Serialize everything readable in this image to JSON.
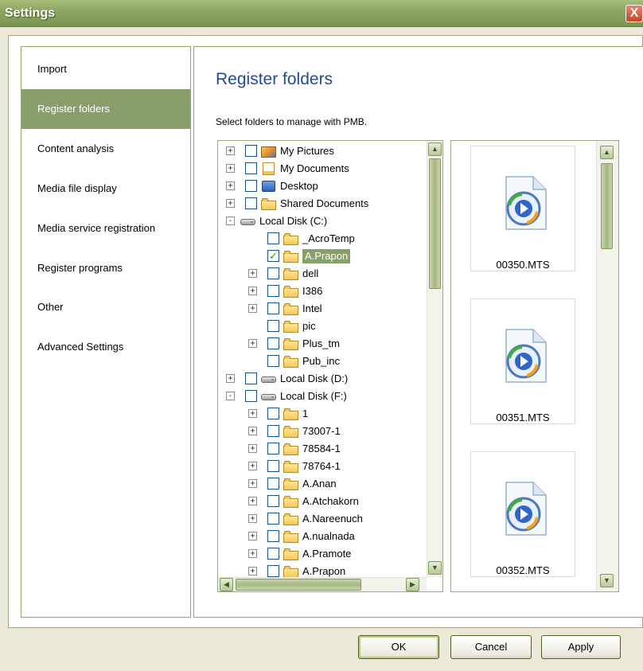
{
  "window": {
    "title": "Settings",
    "close_symbol": "X"
  },
  "nav": {
    "items": [
      {
        "label": "Import",
        "selected": false
      },
      {
        "label": "Register folders",
        "selected": true
      },
      {
        "label": "Content analysis",
        "selected": false
      },
      {
        "label": "Media file display",
        "selected": false
      },
      {
        "label": "Media service registration",
        "selected": false
      },
      {
        "label": "Register programs",
        "selected": false
      },
      {
        "label": "Other",
        "selected": false
      },
      {
        "label": "Advanced Settings",
        "selected": false
      }
    ]
  },
  "main": {
    "heading": "Register folders",
    "subtitle": "Select folders to manage with PMB."
  },
  "tree": {
    "items": [
      {
        "label": "My Pictures",
        "level": 0,
        "expander": "+",
        "checked": false,
        "icon": "pictures-icon"
      },
      {
        "label": "My Documents",
        "level": 0,
        "expander": "+",
        "checked": false,
        "icon": "documents-icon"
      },
      {
        "label": "Desktop",
        "level": 0,
        "expander": "+",
        "checked": false,
        "icon": "desktop-icon"
      },
      {
        "label": "Shared Documents",
        "level": 0,
        "expander": "+",
        "checked": false,
        "icon": "folder-icon"
      },
      {
        "label": "Local Disk (C:)",
        "level": 0,
        "expander": "-",
        "checked": null,
        "icon": "drive-icon"
      },
      {
        "label": "_AcroTemp",
        "level": 1,
        "expander": "",
        "checked": false,
        "icon": "folder-icon"
      },
      {
        "label": "A.Prapon",
        "level": 1,
        "expander": "",
        "checked": true,
        "icon": "folder-icon",
        "selected": true
      },
      {
        "label": "dell",
        "level": 1,
        "expander": "+",
        "checked": false,
        "icon": "folder-icon"
      },
      {
        "label": "I386",
        "level": 1,
        "expander": "+",
        "checked": false,
        "icon": "folder-icon"
      },
      {
        "label": "Intel",
        "level": 1,
        "expander": "+",
        "checked": false,
        "icon": "folder-icon"
      },
      {
        "label": "pic",
        "level": 1,
        "expander": "",
        "checked": false,
        "icon": "folder-icon"
      },
      {
        "label": "Plus_tm",
        "level": 1,
        "expander": "+",
        "checked": false,
        "icon": "folder-icon"
      },
      {
        "label": "Pub_inc",
        "level": 1,
        "expander": "",
        "checked": false,
        "icon": "folder-icon"
      },
      {
        "label": "Local Disk (D:)",
        "level": 0,
        "expander": "+",
        "checked": false,
        "icon": "drive-icon"
      },
      {
        "label": "Local Disk (F:)",
        "level": 0,
        "expander": "-",
        "checked": false,
        "icon": "drive-icon"
      },
      {
        "label": "1",
        "level": 1,
        "expander": "+",
        "checked": false,
        "icon": "folder-icon"
      },
      {
        "label": "73007-1",
        "level": 1,
        "expander": "+",
        "checked": false,
        "icon": "folder-icon"
      },
      {
        "label": "78584-1",
        "level": 1,
        "expander": "+",
        "checked": false,
        "icon": "folder-icon"
      },
      {
        "label": "78764-1",
        "level": 1,
        "expander": "+",
        "checked": false,
        "icon": "folder-icon"
      },
      {
        "label": "A.Anan",
        "level": 1,
        "expander": "+",
        "checked": false,
        "icon": "folder-icon"
      },
      {
        "label": "A.Atchakorn",
        "level": 1,
        "expander": "+",
        "checked": false,
        "icon": "folder-icon"
      },
      {
        "label": "A.Nareenuch",
        "level": 1,
        "expander": "+",
        "checked": false,
        "icon": "folder-icon"
      },
      {
        "label": "A.nualnada",
        "level": 1,
        "expander": "+",
        "checked": false,
        "icon": "folder-icon"
      },
      {
        "label": "A.Pramote",
        "level": 1,
        "expander": "+",
        "checked": false,
        "icon": "folder-icon"
      },
      {
        "label": "A.Prapon",
        "level": 1,
        "expander": "+",
        "checked": false,
        "icon": "folder-icon"
      }
    ]
  },
  "media": {
    "files": [
      {
        "name": "00350.MTS",
        "icon": "media-player-icon"
      },
      {
        "name": "00351.MTS",
        "icon": "media-player-icon"
      },
      {
        "name": "00352.MTS",
        "icon": "media-player-icon"
      }
    ]
  },
  "buttons": {
    "ok": "OK",
    "cancel": "Cancel",
    "apply": "Apply"
  },
  "colors": {
    "accent": "#8a9e6c",
    "heading": "#1f4a9c",
    "titlebar": "#8da662"
  },
  "icons": {
    "scroll_up": "▲",
    "scroll_down": "▼",
    "scroll_left": "◀",
    "scroll_right": "▶"
  }
}
